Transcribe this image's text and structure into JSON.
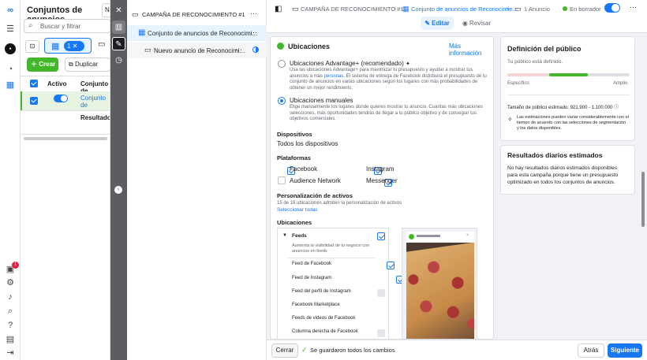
{
  "left_panel": {
    "title": "Conjuntos de anuncios",
    "search_placeholder": "Buscar y filtrar",
    "selected_count": "1",
    "create_label": "Crear",
    "duplicate_label": "Duplicar",
    "col_active": "Activo",
    "col_name": "Conjunto de",
    "row_name": "Conjunto de",
    "results_label": "Resultados",
    "notification_badge": "1"
  },
  "tree": {
    "campaign": "CAMPAÑA DE RECONOCIMIENTO #1",
    "adset": "Conjunto de anuncios de Reconocimi...",
    "ad": "Nuevo anuncio de Reconocimi..."
  },
  "topbar": {
    "breadcrumb_campaign": "CAMPAÑA DE RECONOCIMIENTO #1",
    "breadcrumb_adset": "Conjunto de anuncios de Reconocimie...",
    "breadcrumb_ad": "1 Anuncio",
    "status": "En borrador",
    "edit_label": "Editar",
    "review_label": "Revisar"
  },
  "placements": {
    "title": "Ubicaciones",
    "more_info": "Más información",
    "advantage_title": "Ubicaciones Advantage+ (recomendado)",
    "advantage_desc_1": "Usa las ubicaciones Advantage+ para maximizar tu presupuesto y ayudar a mostrar tus anuncios a más",
    "advantage_link": "personas",
    "advantage_desc_2": ". El sistema de entrega de Facebook distribuirá el presupuesto de tu conjunto de anuncios en varias ubicaciones según los lugares con más probabilidades de obtener un mejor rendimiento.",
    "manual_title": "Ubicaciones manuales",
    "manual_desc": "Elige manualmente los lugares donde quieres mostrar tu anuncio. Cuantas más ubicaciones selecciones, más oportunidades tendrás de llegar a tu público objetivo y de conseguir tus objetivos comerciales.",
    "devices_label": "Dispositivos",
    "devices_value": "Todos los dispositivos",
    "platforms_label": "Plataformas",
    "platforms": [
      "Facebook",
      "Instagram",
      "Audience Network",
      "Messenger"
    ],
    "asset_custom_label": "Personalización de activos",
    "asset_custom_desc": "15 de 16 ubicaciones admiten la personalización de activos",
    "select_all": "Seleccionar todas",
    "placements_label": "Ubicaciones",
    "feeds_title": "Feeds",
    "feeds_desc": "Aumenta la visibilidad de tu negocio con anuncios en feeds",
    "feed_items": [
      "Feed de Facebook",
      "Feed de Instagram",
      "Feed del perfil de Instagram",
      "Facebook Marketplace",
      "Feeds de videos de Facebook",
      "Columna derecha de Facebook"
    ]
  },
  "audience": {
    "title": "Definición del público",
    "defined": "Tu público está definido.",
    "specific": "Específico",
    "broad": "Amplio",
    "size": "Tamaño de público estimado: 921.900 - 1.100.000",
    "note": "Las estimaciones pueden variar considerablemente con el tiempo de acuerdo con las selecciones de segmentación y los datos disponibles.",
    "level": 0.58
  },
  "daily": {
    "title": "Resultados diarios estimados",
    "text": "No hay resultados diarios estimados disponibles para esta campaña porque tiene un presupuesto optimizado en todos los conjuntos de anuncios."
  },
  "footer": {
    "close": "Cerrar",
    "saved": "Se guardaron todos los cambios",
    "back": "Atrás",
    "next": "Siguiente"
  },
  "colors": {
    "accent": "#1877f2",
    "success": "#42b72a"
  }
}
